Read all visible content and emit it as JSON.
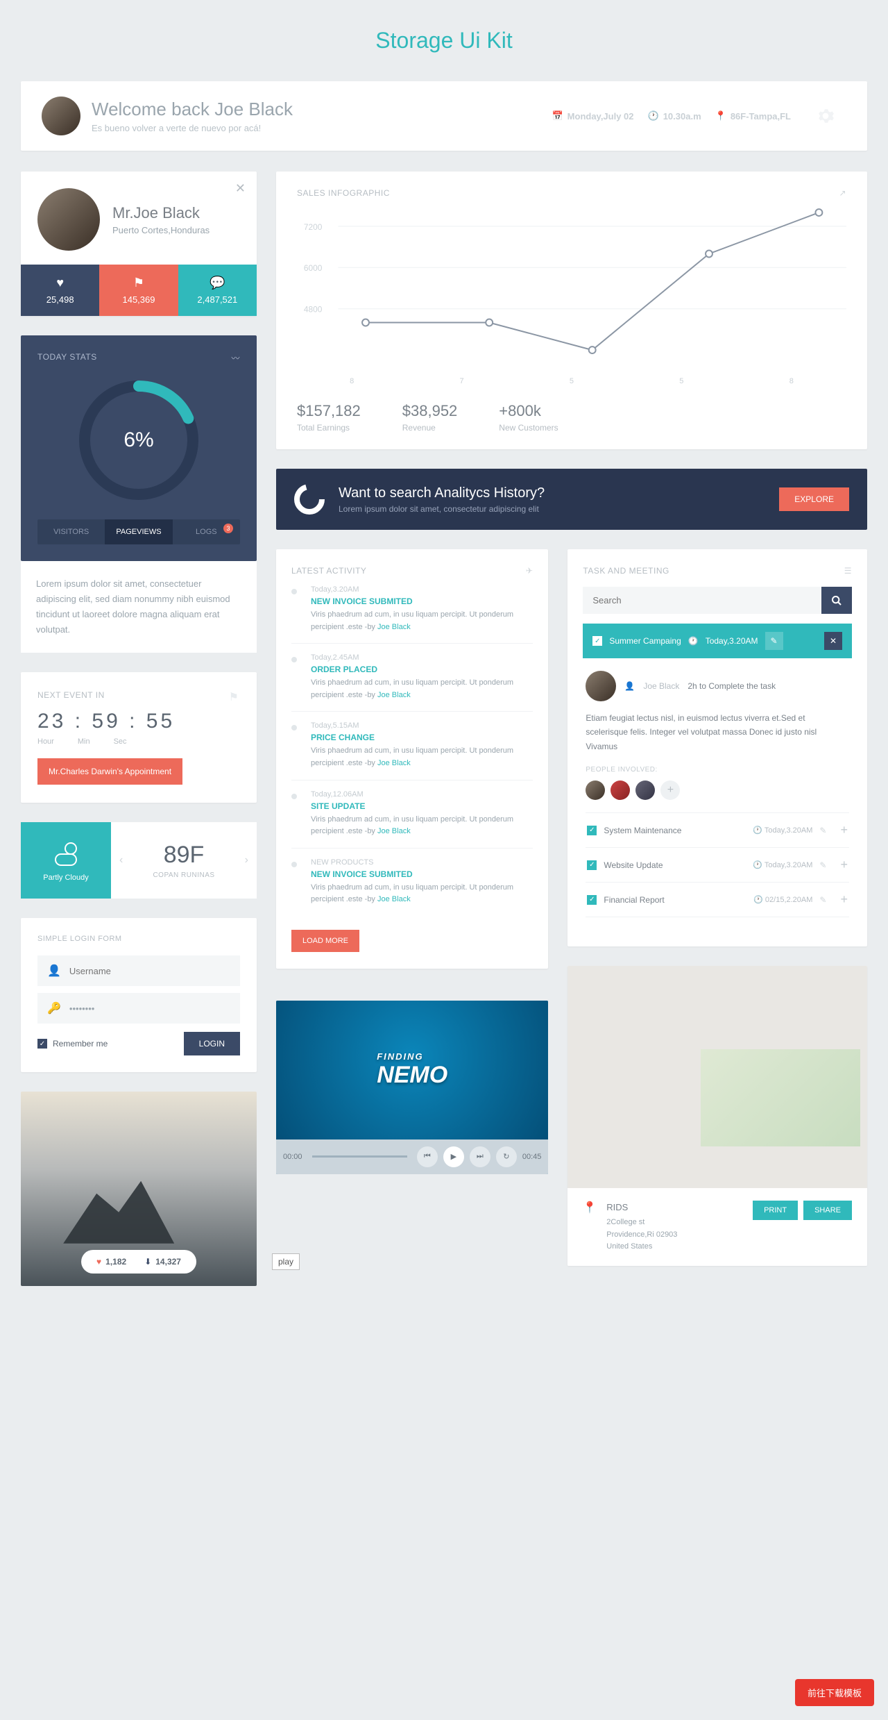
{
  "page_title": "Storage Ui Kit",
  "header": {
    "welcome": "Welcome back Joe Black",
    "sub": "Es bueno volver a verte de nuevo por acá!",
    "date": "Monday,July 02",
    "time": "10.30a.m",
    "loc": "86F-Tampa,FL"
  },
  "profile": {
    "name": "Mr.Joe Black",
    "location": "Puerto Cortes,Honduras",
    "stats": {
      "likes": "25,498",
      "flags": "145,369",
      "comments": "2,487,521"
    }
  },
  "today_stats": {
    "title": "TODAY STATS",
    "pct": "6%",
    "tabs": [
      "VISITORS",
      "PAGEVIEWS",
      "LOGS"
    ],
    "badge": "3",
    "body": "Lorem ipsum dolor sit amet, consectetuer adipiscing elit, sed diam nonummy nibh euismod tincidunt ut laoreet dolore magna aliquam erat volutpat."
  },
  "countdown": {
    "label": "NEXT EVENT IN",
    "h": "23",
    "m": "59",
    "s": "55",
    "uh": "Hour",
    "um": "Min",
    "us": "Sec",
    "event": "Mr.Charles Darwin's Appointment"
  },
  "weather": {
    "desc": "Partly Cloudy",
    "temp": "89F",
    "city": "COPAN RUNINAS"
  },
  "login": {
    "title": "SIMPLE LOGIN FORM",
    "user_ph": "Username",
    "pass_val": "••••••••",
    "remember": "Remember me",
    "btn": "LOGIN"
  },
  "photo": {
    "likes": "1,182",
    "downloads": "14,327"
  },
  "chart": {
    "title": "SALES INFOGRAPHIC",
    "metrics": [
      {
        "v": "$157,182",
        "l": "Total Earnings"
      },
      {
        "v": "$38,952",
        "l": "Revenue"
      },
      {
        "v": "+800k",
        "l": "New Customers"
      }
    ]
  },
  "chart_data": {
    "type": "line",
    "x": [
      "8",
      "7",
      "5",
      "5",
      "8"
    ],
    "values": [
      4400,
      4400,
      3600,
      6400,
      7600
    ],
    "ylim": [
      3000,
      8000
    ],
    "yticks": [
      7200,
      6000,
      4800
    ],
    "title": "SALES INFOGRAPHIC",
    "xlabel": "",
    "ylabel": ""
  },
  "explore": {
    "title": "Want to search Analitycs History?",
    "sub": "Lorem ipsum dolor sit amet, consectetur adipiscing elit",
    "btn": "EXPLORE"
  },
  "activity": {
    "title": "LATEST ACTIVITY",
    "items": [
      {
        "time": "Today,3.20AM",
        "title": "NEW INVOICE SUBMITED",
        "body": "Viris phaedrum ad cum, in usu liquam percipit. Ut ponderum percipient .este -by",
        "by": "Joe Black"
      },
      {
        "time": "Today,2.45AM",
        "title": "ORDER PLACED",
        "body": "Viris phaedrum ad cum, in usu liquam percipit. Ut ponderum percipient .este -by",
        "by": "Joe Black"
      },
      {
        "time": "Today,5.15AM",
        "title": "PRICE CHANGE",
        "body": "Viris phaedrum ad cum, in usu liquam percipit. Ut ponderum percipient .este -by",
        "by": "Joe Black"
      },
      {
        "time": "Today,12.06AM",
        "title": "SITE UPDATE",
        "body": "Viris phaedrum ad cum, in usu liquam percipit. Ut ponderum percipient .este -by",
        "by": "Joe Black"
      },
      {
        "time": "NEW PRODUCTS",
        "title": "NEW INVOICE SUBMITED",
        "body": "Viris phaedrum ad cum, in usu liquam percipit. Ut ponderum percipient .este -by",
        "by": "Joe Black"
      }
    ],
    "load": "LOAD MORE"
  },
  "tasks": {
    "title": "TASK AND MEETING",
    "search_ph": "Search",
    "header": {
      "name": "Summer Campaing",
      "time": "Today,3.20AM"
    },
    "user": {
      "name": "Joe Black",
      "task": "2h to Complete the task"
    },
    "desc": "Etiam feugiat lectus nisl, in euismod lectus viverra et.Sed et scelerisque felis. Integer vel volutpat massa Donec id justo nisl Vivamus",
    "people_lbl": "PEOPLE INVOLVED:",
    "rows": [
      {
        "name": "System Maintenance",
        "time": "Today,3.20AM"
      },
      {
        "name": "Website Update",
        "time": "Today,3.20AM"
      },
      {
        "name": "Financial Report",
        "time": "02/15,2.20AM"
      }
    ]
  },
  "video": {
    "title": "FINDING NEMO",
    "t0": "00:00",
    "t1": "00:45"
  },
  "map": {
    "name": "RIDS",
    "l1": "2College st",
    "l2": "Providence,Ri 02903",
    "l3": "United States",
    "print": "PRINT",
    "share": "SHARE"
  },
  "float_btn": "前往下载模板",
  "play_tag": "play"
}
